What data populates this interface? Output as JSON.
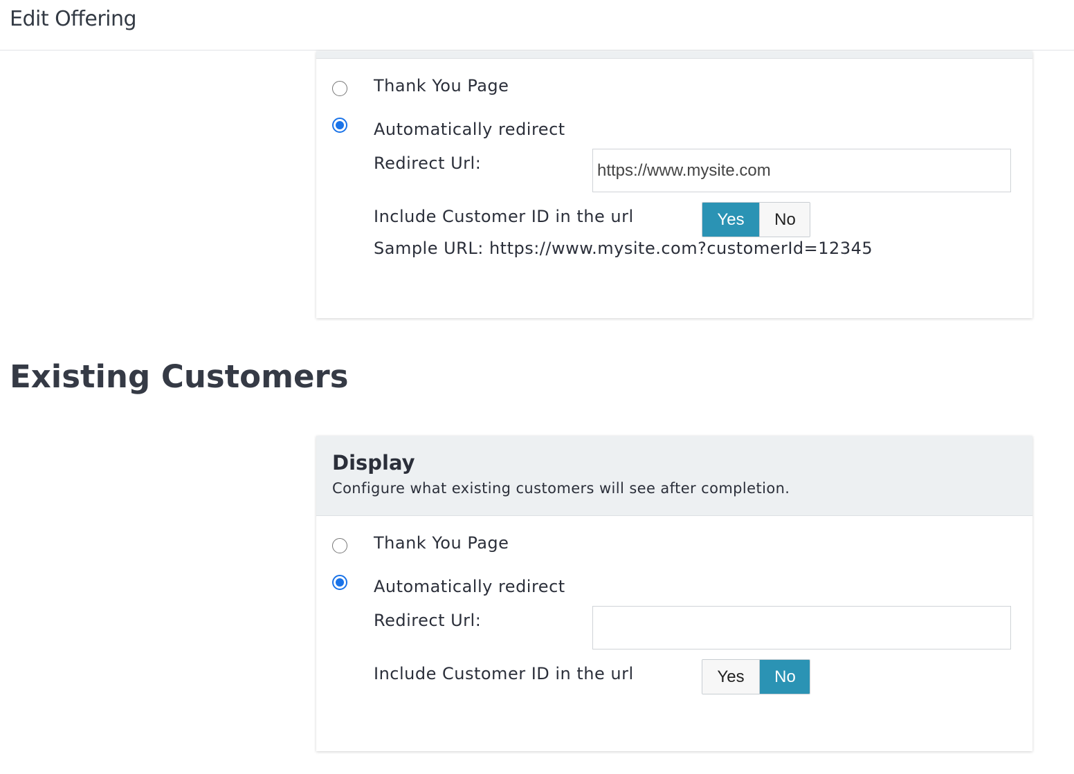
{
  "header": {
    "title": "Edit Offering"
  },
  "new_customers": {
    "options": [
      {
        "label": "Thank You Page",
        "checked": false
      },
      {
        "label": "Automatically redirect",
        "checked": true
      }
    ],
    "redirect_url_label": "Redirect Url:",
    "redirect_url_value": "https://www.mysite.com",
    "include_id_label": "Include Customer ID in the url",
    "toggle": {
      "yes": "Yes",
      "no": "No",
      "selected": "yes"
    },
    "sample_url": "Sample URL: https://www.mysite.com?customerId=12345"
  },
  "existing_customers": {
    "section_title": "Existing Customers",
    "display_title": "Display",
    "display_subtitle": "Configure what existing customers will see after completion.",
    "options": [
      {
        "label": "Thank You Page",
        "checked": false
      },
      {
        "label": "Automatically redirect",
        "checked": true
      }
    ],
    "redirect_url_label": "Redirect Url:",
    "redirect_url_value": "",
    "include_id_label": "Include Customer ID in the url",
    "toggle": {
      "yes": "Yes",
      "no": "No",
      "selected": "no"
    }
  },
  "colors": {
    "accent": "#2b93b4",
    "radio_checked": "#1a73e8",
    "card_header_bg": "#edf0f2"
  }
}
